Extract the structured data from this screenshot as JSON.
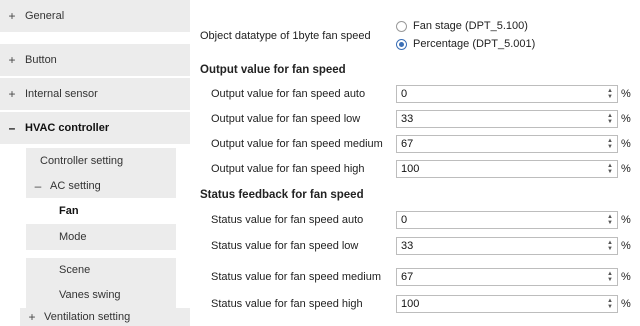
{
  "sidebar": {
    "items": [
      {
        "sign": "+",
        "label": "General"
      },
      {
        "sign": "+",
        "label": "Button"
      },
      {
        "sign": "+",
        "label": "Internal sensor"
      },
      {
        "sign": "–",
        "label": "HVAC controller"
      }
    ],
    "sub_items": [
      {
        "label": "Controller setting"
      },
      {
        "sign": "–",
        "label": "AC setting"
      },
      {
        "label": "Fan"
      },
      {
        "label": "Mode"
      },
      {
        "label": "Scene"
      },
      {
        "label": "Vanes swing"
      },
      {
        "sign": "+",
        "label": "Ventilation setting"
      }
    ]
  },
  "main": {
    "datatype_label": "Object datatype of 1byte fan speed",
    "radio_options": [
      {
        "label": "Fan stage (DPT_5.100)",
        "checked": false
      },
      {
        "label": "Percentage (DPT_5.001)",
        "checked": true
      }
    ],
    "output_section": {
      "title": "Output value for fan speed",
      "rows": [
        {
          "label": "Output value for fan speed auto",
          "value": "0",
          "unit": "%"
        },
        {
          "label": "Output value for fan speed low",
          "value": "33",
          "unit": "%"
        },
        {
          "label": "Output value for fan speed medium",
          "value": "67",
          "unit": "%"
        },
        {
          "label": "Output value for fan speed high",
          "value": "100",
          "unit": "%"
        }
      ]
    },
    "status_section": {
      "title": "Status feedback for fan speed",
      "rows": [
        {
          "label": "Status value for fan speed auto",
          "value": "0",
          "unit": "%"
        },
        {
          "label": "Status value for fan speed low",
          "value": "33",
          "unit": "%"
        },
        {
          "label": "Status value for fan speed medium",
          "value": "67",
          "unit": "%"
        },
        {
          "label": "Status  value for fan speed high",
          "value": "100",
          "unit": "%"
        }
      ]
    },
    "spinner": {
      "up": "▲",
      "down": "▼"
    }
  },
  "colors": {
    "sidebar_bg": "#ececec",
    "active_bg": "#ffffff",
    "radio_accent": "#3b6fb6",
    "field_border": "#bdbdbd"
  }
}
